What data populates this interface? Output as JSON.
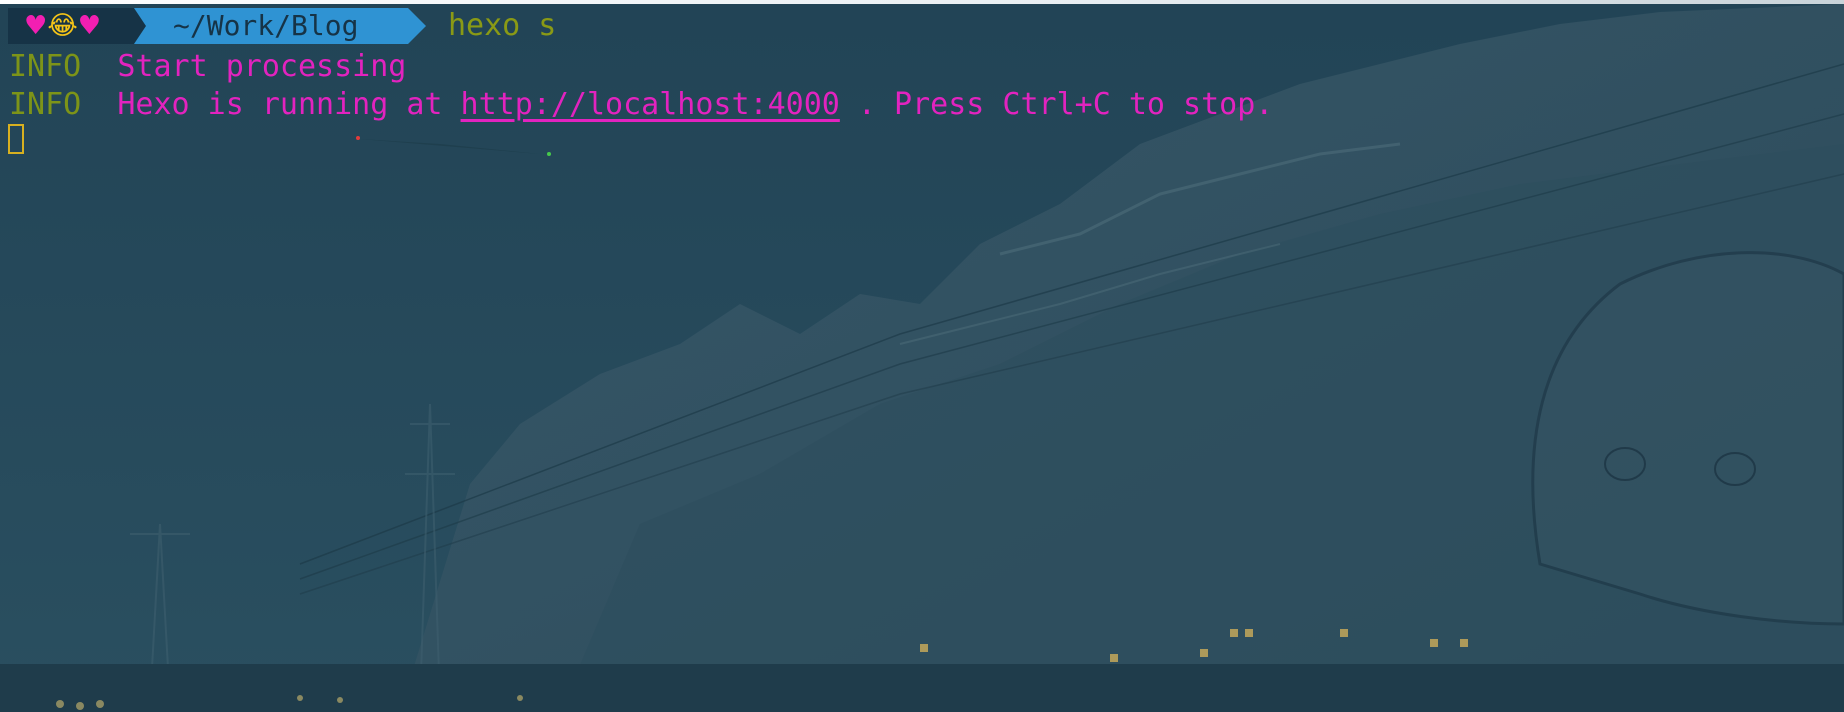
{
  "prompt": {
    "icons": [
      "pink-heart",
      "face-with-tears-of-joy",
      "pink-heart"
    ],
    "path": "~/Work/Blog",
    "command": "hexo s"
  },
  "output": [
    {
      "level": "INFO",
      "message": "Start processing"
    },
    {
      "level": "INFO",
      "message_before": "Hexo is running at ",
      "url": "http://localhost:4000",
      "message_after": " . Press Ctrl+C to stop."
    }
  ],
  "colors": {
    "info": "#7d9418",
    "message": "#e223bf",
    "command": "#8a9a15",
    "path_segment_bg": "#2f93d3",
    "icon_segment_bg": "#163346",
    "cursor": "#d7b020",
    "background": "#26485a"
  }
}
